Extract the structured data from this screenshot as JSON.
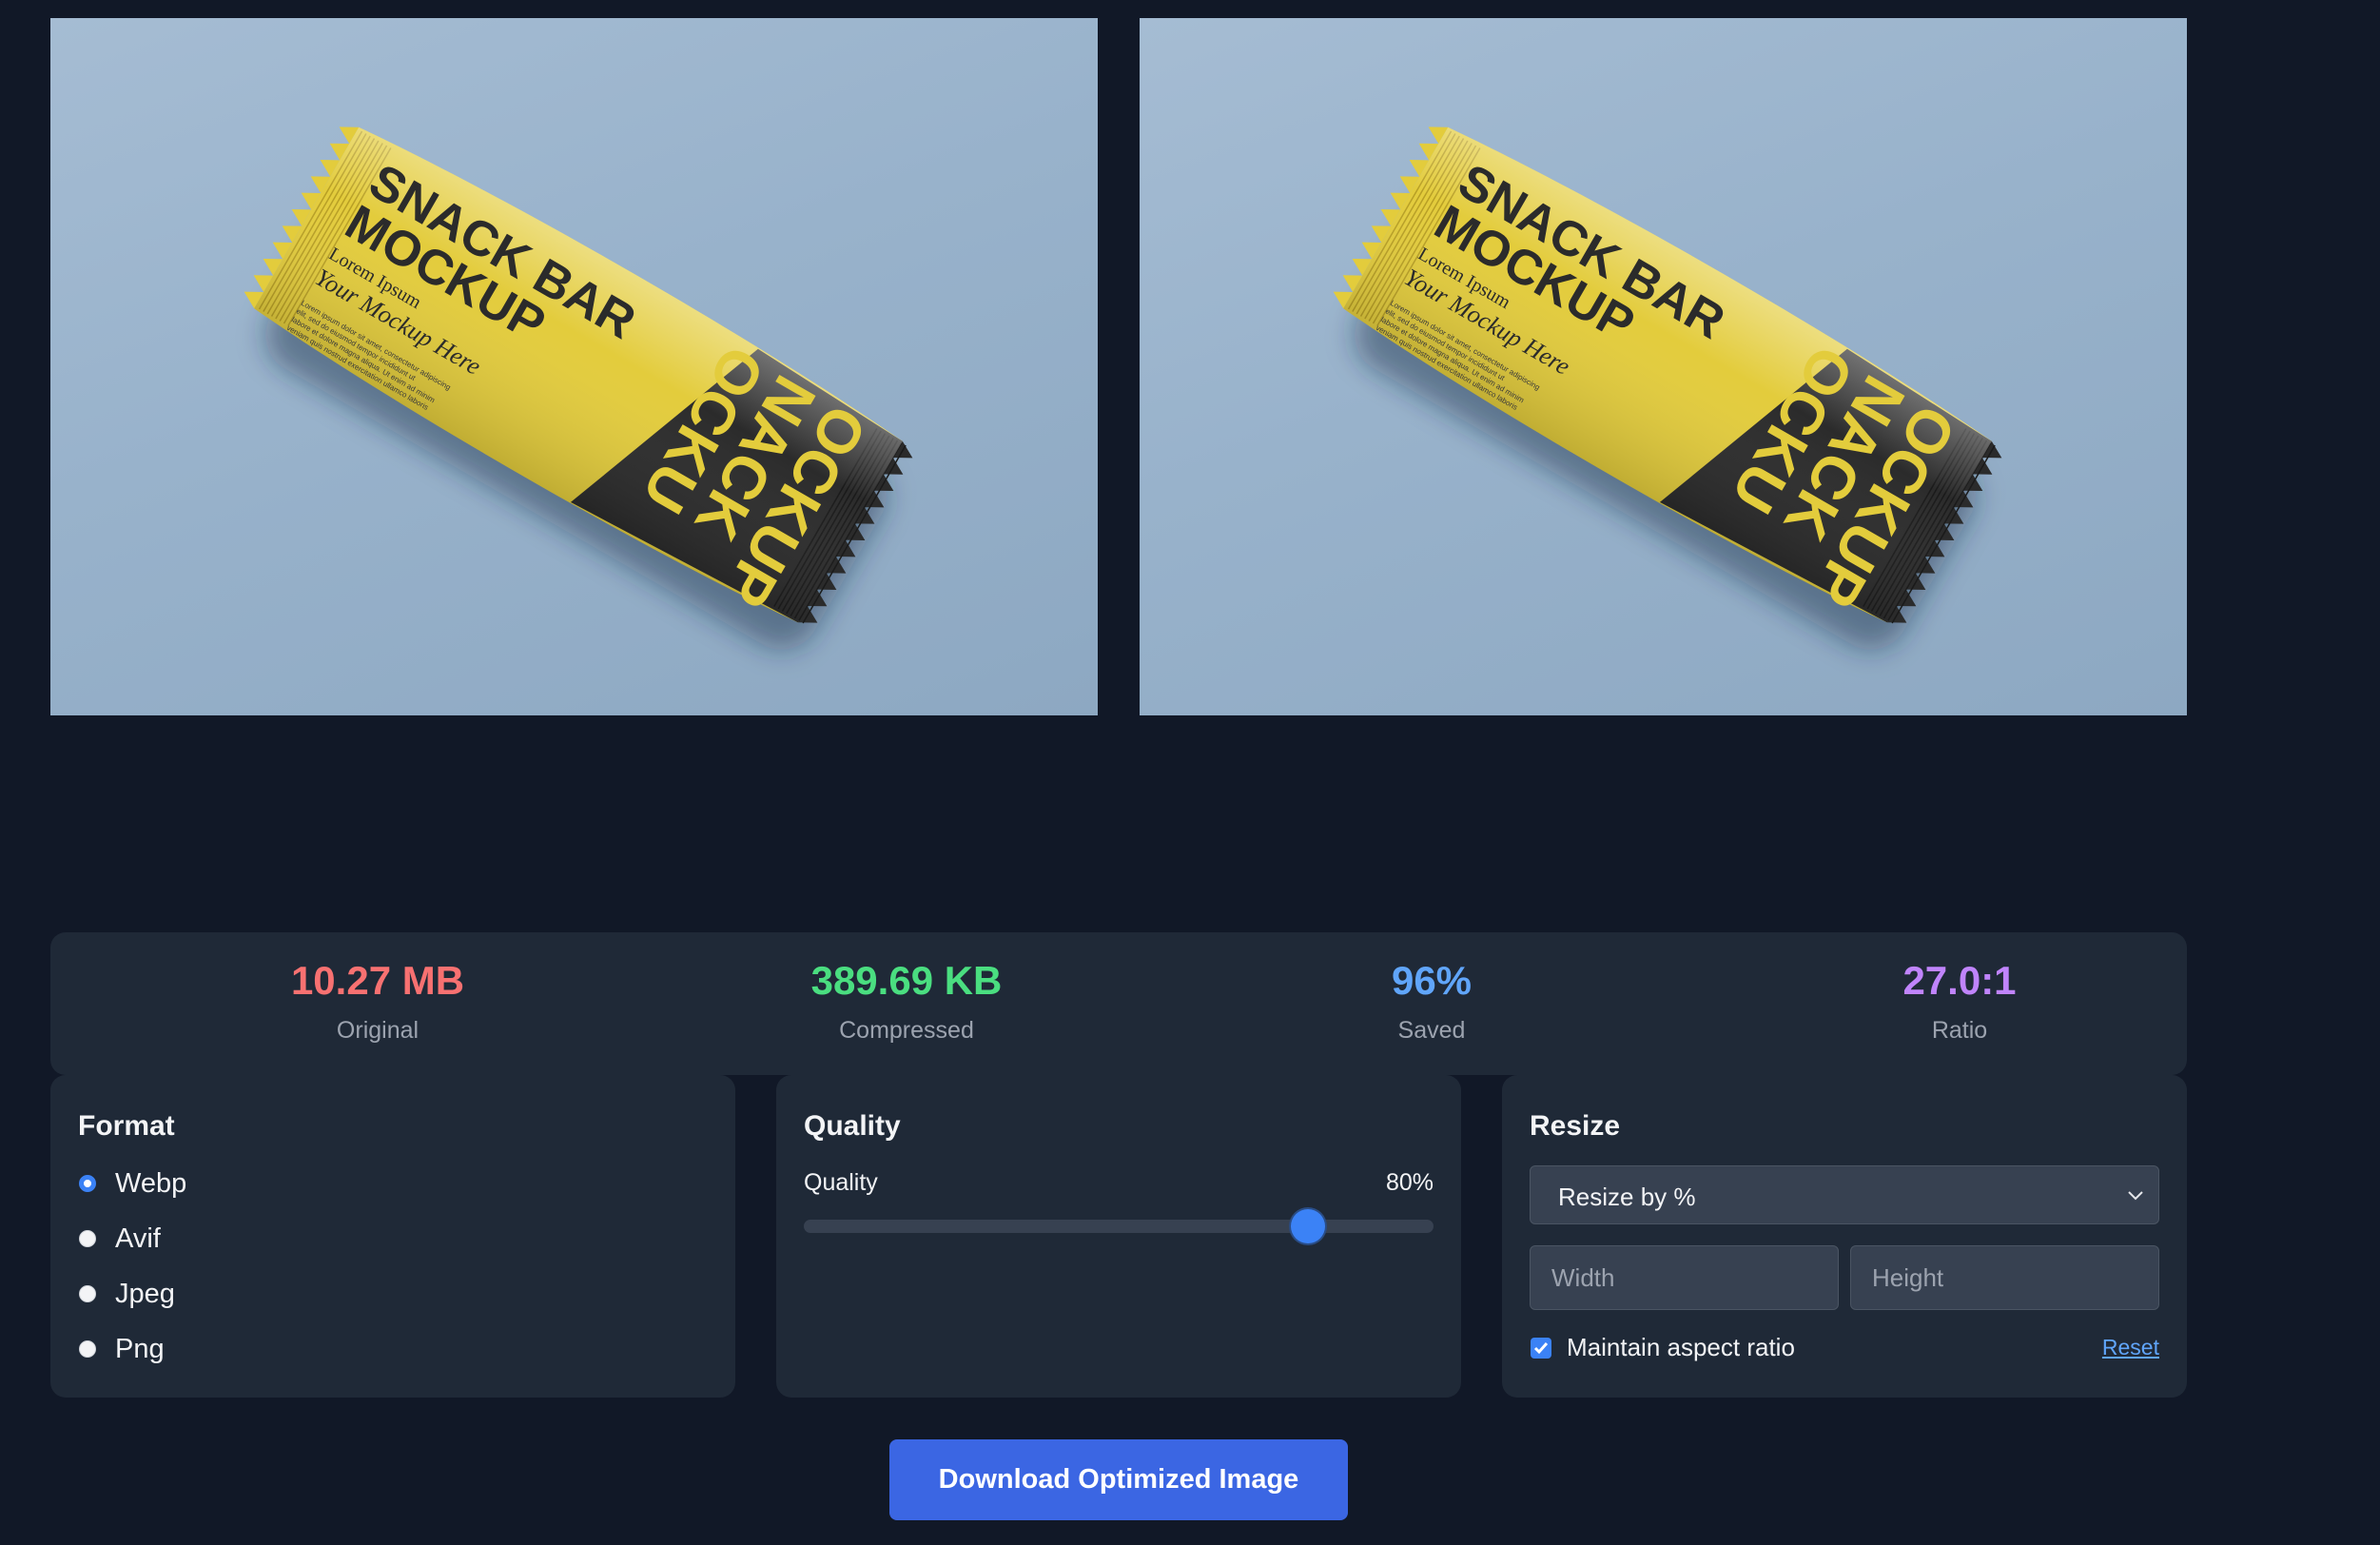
{
  "previews": {
    "original": {
      "headline": [
        "SNACK BAR",
        "MOCKUP"
      ],
      "tagline": "Lorem Ipsum",
      "script": "Your Mockup Here",
      "body_text": [
        "Lorem ipsum dolor sit amet, consectetur adipiscing",
        "elit, sed do eiusmod tempor incididunt ut",
        "labore et dolore magna aliqua. Ut enim ad minim",
        "veniam quis nostrud exercitation ullamco laboris"
      ],
      "side_words": [
        "OCKUP",
        "NACK",
        "OCKU"
      ]
    },
    "compressed": {
      "headline": [
        "SNACK BAR",
        "MOCKUP"
      ],
      "tagline": "Lorem Ipsum",
      "script": "Your Mockup Here",
      "body_text": [
        "Lorem ipsum dolor sit amet, consectetur adipiscing",
        "elit, sed do eiusmod tempor incididunt ut",
        "labore et dolore magna aliqua. Ut enim ad minim",
        "veniam quis nostrud exercitation ullamco laboris"
      ],
      "side_words": [
        "OCKUP",
        "NACK",
        "OCKU"
      ]
    }
  },
  "stats": {
    "original": {
      "value": "10.27 MB",
      "label": "Original",
      "color": "#f87171"
    },
    "compressed": {
      "value": "389.69 KB",
      "label": "Compressed",
      "color": "#4ade80"
    },
    "saved": {
      "value": "96%",
      "label": "Saved",
      "color": "#60a5fa"
    },
    "ratio": {
      "value": "27.0:1",
      "label": "Ratio",
      "color": "#c084fc"
    }
  },
  "format": {
    "title": "Format",
    "options": [
      {
        "label": "Webp",
        "selected": true
      },
      {
        "label": "Avif",
        "selected": false
      },
      {
        "label": "Jpeg",
        "selected": false
      },
      {
        "label": "Png",
        "selected": false
      }
    ]
  },
  "quality": {
    "title": "Quality",
    "label": "Quality",
    "value_text": "80%",
    "value": 0.8
  },
  "resize": {
    "title": "Resize",
    "mode": "Resize by %",
    "width_placeholder": "Width",
    "height_placeholder": "Height",
    "maintain_label": "Maintain aspect ratio",
    "maintain_checked": true,
    "reset_label": "Reset"
  },
  "download_label": "Download Optimized Image",
  "colors": {
    "background": "#111827",
    "card": "#1f2937",
    "accent": "#3b82f6",
    "wrapper_yellow": "#e3cc3c",
    "wrapper_dark": "#2b2b2b"
  }
}
